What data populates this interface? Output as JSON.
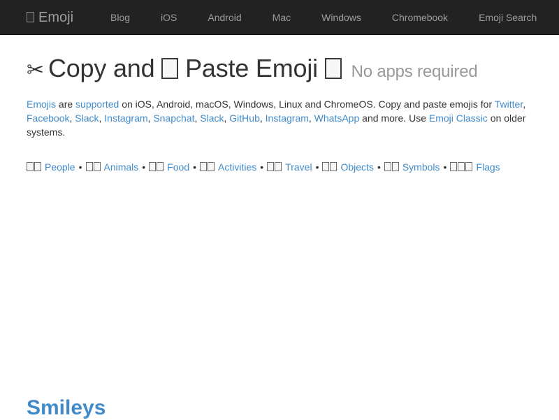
{
  "colors": {
    "navbar_bg": "#222222",
    "nav_text": "#9d9d9d",
    "link_blue": "#428bca",
    "body_text": "#333333",
    "muted_text": "#999999",
    "page_bg": "#ffffff"
  },
  "navbar": {
    "brand": {
      "icon": "tofu-box-icon",
      "label": "Emoji"
    },
    "items": [
      {
        "label": "Blog"
      },
      {
        "label": "iOS"
      },
      {
        "label": "Android"
      },
      {
        "label": "Mac"
      },
      {
        "label": "Windows"
      },
      {
        "label": "Chromebook"
      },
      {
        "label": "Emoji Search"
      }
    ]
  },
  "heading": {
    "scissors_icon": "✂",
    "text_before_box": "Copy and",
    "box_icon": "tofu-box-icon",
    "text_after_box": "Paste Emoji",
    "trailing_box_icon": "tofu-box-icon",
    "subtitle": "No apps required"
  },
  "lead": {
    "link_emojis": "Emojis",
    "t1": " are ",
    "link_supported": "supported",
    "t2": " on iOS, Android, macOS, Windows, Linux and ChromeOS. Copy and paste emojis for ",
    "link_twitter": "Twitter",
    "t3": ", ",
    "link_facebook": "Facebook",
    "t4": ", ",
    "link_slack1": "Slack",
    "t5": ", ",
    "link_instagram1": "Instagram",
    "t6": ", ",
    "link_snapchat": "Snapchat",
    "t7": ", ",
    "link_slack2": "Slack",
    "t8": ", ",
    "link_github": "GitHub",
    "t9": ", ",
    "link_instagram2": "Instagram",
    "t10": ", ",
    "link_whatsapp": "WhatsApp",
    "t11": " and more. Use ",
    "link_emoji_classic": "Emoji Classic",
    "t12": " on older systems."
  },
  "categories": {
    "separator": "•",
    "items": [
      {
        "label": "People",
        "boxes": 2,
        "icon": "tofu-box-icon"
      },
      {
        "label": "Animals",
        "boxes": 2,
        "icon": "tofu-box-icon"
      },
      {
        "label": "Food",
        "boxes": 2,
        "icon": "tofu-box-icon"
      },
      {
        "label": "Activities",
        "boxes": 2,
        "icon": "tofu-box-icon"
      },
      {
        "label": "Travel",
        "boxes": 2,
        "icon": "tofu-box-icon"
      },
      {
        "label": "Objects",
        "boxes": 2,
        "icon": "tofu-box-icon"
      },
      {
        "label": "Symbols",
        "boxes": 2,
        "icon": "tofu-box-icon"
      },
      {
        "label": "Flags",
        "boxes": 3,
        "icon": "tofu-box-icon"
      }
    ]
  },
  "section": {
    "title": "Smileys"
  }
}
